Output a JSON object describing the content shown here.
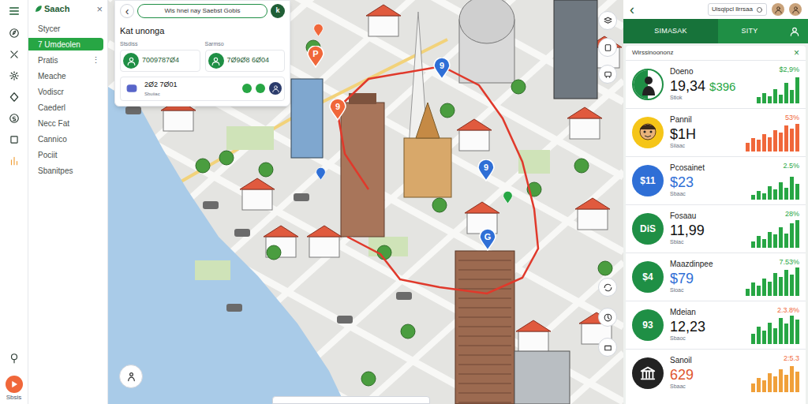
{
  "sidebar": {
    "logo": "Saach",
    "close": "×",
    "more": "⋮",
    "items": [
      {
        "label": "Stycer",
        "selected": false
      },
      {
        "label": "7 Umdeolen",
        "selected": true
      },
      {
        "label": "Pratis",
        "selected": false
      },
      {
        "label": "Meache",
        "selected": false
      },
      {
        "label": "Vodiscr",
        "selected": false
      },
      {
        "label": "Caederl",
        "selected": false
      },
      {
        "label": "Necc Fat",
        "selected": false
      },
      {
        "label": "Cannico",
        "selected": false
      },
      {
        "label": "Pociit",
        "selected": false
      },
      {
        "label": "Sbanitpes",
        "selected": false
      }
    ],
    "bottom_label": "Sbsis"
  },
  "map": {
    "search": {
      "back": "‹",
      "text": "Wis hnei nay Saebst Gobis",
      "action": "k"
    },
    "card": {
      "title": "Kat unonga",
      "labels": [
        "Stsdiss",
        "Sarmso"
      ],
      "entries": [
        "7009787Ø4",
        "7Ø9Ø8 6Ø04"
      ],
      "row": {
        "text": "2Ø2 7Ø01",
        "sub": "Sbuiiac"
      }
    },
    "pins": [
      {
        "kind": "letter",
        "label": "P",
        "color": "#f0673a"
      },
      {
        "kind": "letter",
        "label": "9",
        "color": "#f0673a"
      },
      {
        "kind": "letter",
        "label": "9",
        "color": "#2f6fd6"
      },
      {
        "kind": "letter",
        "label": "9",
        "color": "#2f6fd6"
      },
      {
        "kind": "letter",
        "label": "G",
        "color": "#2f6fd6"
      },
      {
        "kind": "dot",
        "color": "#27a644"
      },
      {
        "kind": "dot",
        "color": "#2f6fd6"
      },
      {
        "kind": "dot",
        "color": "#f0673a"
      }
    ]
  },
  "right_panel": {
    "back": "‹",
    "search": "Uisqipcl llrrsaa",
    "tabs": [
      {
        "label": "SIMASAK",
        "selected": true
      },
      {
        "label": "SITY",
        "selected": false
      }
    ],
    "list": {
      "title": "Wirssinoononz",
      "close": "×",
      "rows": [
        {
          "name": "Doeno",
          "value": "19,34",
          "value_color": "#111111",
          "price": "$396",
          "change": "$2,9%",
          "change_color": "#27a644",
          "sub": "Stiok",
          "icon": {
            "kind": "figure",
            "color": "#1f8f45"
          },
          "bar_color": "#27a644",
          "bars": [
            20,
            35,
            25,
            50,
            30,
            70,
            45,
            90
          ]
        },
        {
          "name": "Pannil",
          "value": "$1H",
          "value_color": "#111111",
          "change": "53%",
          "change_color": "#f0673a",
          "sub": "Siiaac",
          "icon": {
            "kind": "avatar",
            "color": "#f5c518"
          },
          "bar_color": "#f0673a",
          "bars": [
            30,
            45,
            40,
            60,
            50,
            75,
            65,
            90,
            80,
            95
          ]
        },
        {
          "name": "Pcosainet",
          "value": "$23",
          "value_color": "#2f6fd6",
          "change": "2.5%",
          "change_color": "#27a644",
          "sub": "Sbaac",
          "icon": {
            "kind": "text",
            "text": "$11",
            "color": "#2f6fd6"
          },
          "bar_color": "#27a644",
          "bars": [
            15,
            30,
            20,
            45,
            35,
            60,
            40,
            80,
            55
          ]
        },
        {
          "name": "Fosaau",
          "value": "11,99",
          "value_color": "#111111",
          "change": "28%",
          "change_color": "#27a644",
          "sub": "Sbiac",
          "icon": {
            "kind": "text",
            "text": "DiS",
            "color": "#1f8f45"
          },
          "bar_color": "#27a644",
          "bars": [
            20,
            40,
            30,
            55,
            45,
            70,
            50,
            85,
            95
          ]
        },
        {
          "name": "Maazdinpee",
          "value": "$79",
          "value_color": "#2f6fd6",
          "change": "7.53%",
          "change_color": "#27a644",
          "sub": "Sioac",
          "icon": {
            "kind": "text",
            "text": "$4",
            "color": "#1f8f45"
          },
          "bar_color": "#27a644",
          "bars": [
            25,
            45,
            35,
            60,
            50,
            80,
            65,
            90,
            75,
            100
          ]
        },
        {
          "name": "Mdeian",
          "value": "12,23",
          "value_color": "#111111",
          "change": "2.3.8%",
          "change_color": "#f0673a",
          "sub": "Sbaoc",
          "icon": {
            "kind": "text",
            "text": "93",
            "color": "#1f8f45"
          },
          "bar_color": "#27a644",
          "bars": [
            35,
            60,
            45,
            75,
            55,
            90,
            70,
            100,
            85
          ]
        },
        {
          "name": "Sanoil",
          "value": "629",
          "value_color": "#e0562e",
          "change": "2:5.3",
          "change_color": "#f0673a",
          "sub": "Sbaac",
          "icon": {
            "kind": "bank",
            "color": "#222222"
          },
          "bar_color": "#f0a03a",
          "bars": [
            30,
            50,
            40,
            65,
            55,
            80,
            60,
            90,
            70
          ]
        }
      ]
    }
  }
}
